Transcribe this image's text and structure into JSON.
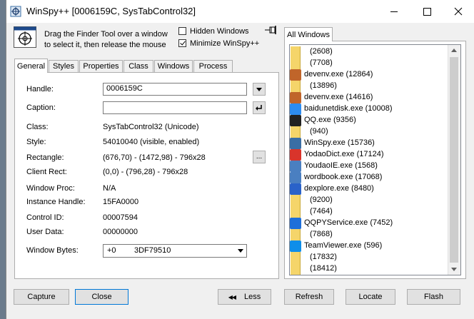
{
  "window": {
    "title": "WinSpy++ [0006159C, SysTabControl32]"
  },
  "finder": {
    "instructions_line1": "Drag the Finder Tool over a window",
    "instructions_line2": "to select it, then release the mouse",
    "hidden_windows_label": "Hidden Windows",
    "hidden_windows_checked": false,
    "minimize_label": "Minimize WinSpy++",
    "minimize_checked": true
  },
  "tabs": [
    {
      "label": "General",
      "active": true
    },
    {
      "label": "Styles",
      "active": false
    },
    {
      "label": "Properties",
      "active": false
    },
    {
      "label": "Class",
      "active": false
    },
    {
      "label": "Windows",
      "active": false
    },
    {
      "label": "Process",
      "active": false
    }
  ],
  "general": {
    "handle_label": "Handle:",
    "handle_value": "0006159C",
    "caption_label": "Caption:",
    "caption_value": "",
    "class_label": "Class:",
    "class_value": "SysTabControl32  (Unicode)",
    "style_label": "Style:",
    "style_value": "54010040  (visible, enabled)",
    "rectangle_label": "Rectangle:",
    "rectangle_value": "(676,70) - (1472,98)  -  796x28",
    "client_rect_label": "Client Rect:",
    "client_rect_value": "(0,0) - (796,28)  -  796x28",
    "window_proc_label": "Window Proc:",
    "window_proc_value": "N/A",
    "instance_handle_label": "Instance Handle:",
    "instance_handle_value": "15FA0000",
    "control_id_label": "Control ID:",
    "control_id_value": "00007594",
    "user_data_label": "User Data:",
    "user_data_value": "00000000",
    "window_bytes_label": "Window Bytes:",
    "window_bytes_offset": "+0",
    "window_bytes_value": "3DF79510",
    "rect_button_label": "..."
  },
  "all_windows": {
    "tab_label": "All Windows",
    "items": [
      {
        "text": "(2608)",
        "kind": "sub",
        "icon": ""
      },
      {
        "text": "(7708)",
        "kind": "sub",
        "icon": ""
      },
      {
        "text": "devenv.exe  (12864)",
        "kind": "proc",
        "icon": "devenv-icon",
        "color": "#c0652a"
      },
      {
        "text": "(13896)",
        "kind": "sub",
        "icon": ""
      },
      {
        "text": "devenv.exe  (14616)",
        "kind": "proc",
        "icon": "devenv-icon",
        "color": "#c0652a"
      },
      {
        "text": "baidunetdisk.exe  (10008)",
        "kind": "proc",
        "icon": "cloud-icon",
        "color": "#2d8cf0"
      },
      {
        "text": "QQ.exe  (9356)",
        "kind": "proc",
        "icon": "penguin-icon",
        "color": "#222222"
      },
      {
        "text": "(940)",
        "kind": "sub",
        "icon": ""
      },
      {
        "text": "WinSpy.exe  (15736)",
        "kind": "proc",
        "icon": "spy-icon",
        "color": "#3a6ea5"
      },
      {
        "text": "YodaoDict.exe  (17124)",
        "kind": "proc",
        "icon": "dict-icon",
        "color": "#d9342b"
      },
      {
        "text": "YoudaoIE.exe  (1568)",
        "kind": "proc",
        "icon": "window-icon",
        "color": "#4a7fc1"
      },
      {
        "text": "wordbook.exe  (17068)",
        "kind": "proc",
        "icon": "window-icon",
        "color": "#4a7fc1"
      },
      {
        "text": "dexplore.exe  (8480)",
        "kind": "proc",
        "icon": "help-icon",
        "color": "#2a62c9"
      },
      {
        "text": "(9200)",
        "kind": "sub",
        "icon": ""
      },
      {
        "text": "(7464)",
        "kind": "sub",
        "icon": ""
      },
      {
        "text": "QQPYService.exe  (7452)",
        "kind": "proc",
        "icon": "qq-pinyin-icon",
        "color": "#1e6fd9"
      },
      {
        "text": "(7868)",
        "kind": "sub",
        "icon": ""
      },
      {
        "text": "TeamViewer.exe  (596)",
        "kind": "proc",
        "icon": "teamviewer-icon",
        "color": "#0e8ee9"
      },
      {
        "text": "(17832)",
        "kind": "sub",
        "icon": ""
      },
      {
        "text": "(18412)",
        "kind": "sub",
        "icon": ""
      }
    ]
  },
  "buttons": {
    "capture": "Capture",
    "close": "Close",
    "less": "Less",
    "refresh": "Refresh",
    "locate": "Locate",
    "flash": "Flash"
  }
}
